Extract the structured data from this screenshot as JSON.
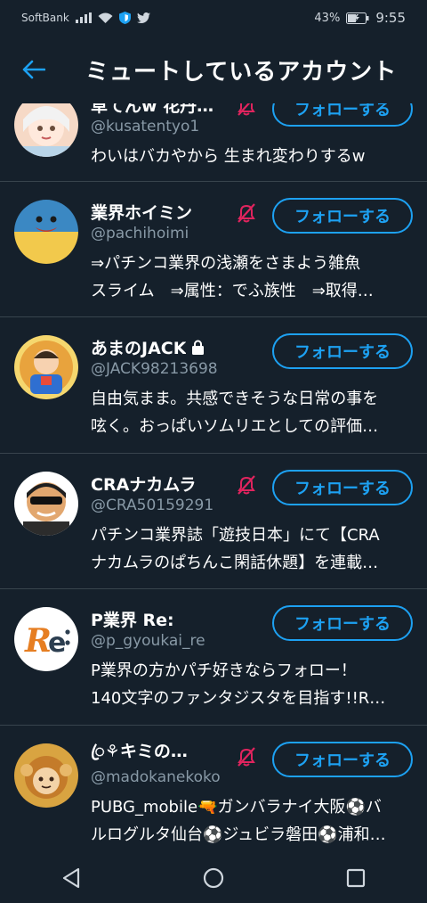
{
  "status_bar": {
    "carrier": "SoftBank",
    "battery": "43%",
    "time": "9:55"
  },
  "header": {
    "title": "ミュートしているアカウント"
  },
  "accounts": [
    {
      "name": "草てんw 花丹…",
      "handle": "@kusatentyo1",
      "bio": [
        "わいはバカやから 生まれ変わりするw"
      ],
      "follow_label": "フォローする",
      "locked": false
    },
    {
      "name": "業界ホイミン",
      "handle": "@pachihoimi",
      "bio": [
        "⇒パチンコ業界の浅瀬をさまよう雑魚",
        "スライム　⇒属性：でふ族性　⇒取得…"
      ],
      "follow_label": "フォローする",
      "locked": false
    },
    {
      "name": "あまのJACK",
      "handle": "@JACK98213698",
      "bio": [
        "自由気まま。共感できそうな日常の事を",
        "呟く。おっぱいソムリエとしての評価…"
      ],
      "follow_label": "フォローする",
      "locked": true
    },
    {
      "name": "CRAナカムラ",
      "handle": "@CRA50159291",
      "bio": [
        "パチンコ業界誌「遊技日本」にて【CRA",
        "ナカムラのぱちんこ閑話休題】を連載…"
      ],
      "follow_label": "フォローする",
      "locked": false
    },
    {
      "name": "P業界 Re:",
      "handle": "@p_gyoukai_re",
      "bio": [
        "P業界の方かパチ好きならフォロー！",
        "140文字のファンタジスタを目指す!!R…"
      ],
      "follow_label": "フォローする",
      "locked": false
    },
    {
      "name": "ꦿ⚘キミの…",
      "handle": "@madokanekoko",
      "bio": [
        "PUBG_mobile🔫ガンバラナイ大阪⚽バ",
        "ルログルタ仙台⚽ジュビラ磐田⚽浦和…"
      ],
      "follow_label": "フォローする",
      "locked": false
    }
  ],
  "colors": {
    "background": "#15202b",
    "accent": "#1da1f2",
    "muted_icon": "#e0245e",
    "secondary_text": "#8899a6",
    "divider": "#38444d"
  },
  "icons": {
    "back": "arrow-left-icon",
    "mute": "bell-slash-icon",
    "lock": "lock-icon",
    "nav_back": "triangle-back-icon",
    "nav_home": "circle-home-icon",
    "nav_recent": "square-recent-icon"
  }
}
